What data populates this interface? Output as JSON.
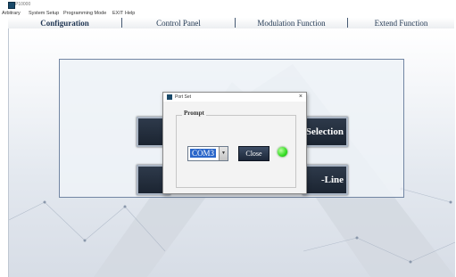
{
  "window": {
    "title": "P10000"
  },
  "menubar": {
    "items": [
      "Arbitrary",
      "System Setup",
      "Programming Mode",
      "EXIT",
      "Help"
    ]
  },
  "tabs": [
    {
      "label": "Configuration",
      "active": true
    },
    {
      "label": "Control Panel",
      "active": false
    },
    {
      "label": "Modulation Function",
      "active": false
    },
    {
      "label": "Extend Function",
      "active": false
    }
  ],
  "main": {
    "buttons": [
      "Selection",
      "-Line"
    ]
  },
  "dialog": {
    "title": "Port Set",
    "close_glyph": "×",
    "group_label": "Prompt",
    "port_value": "COM3",
    "port_arrow": "▼",
    "close_label": "Close",
    "status_color": "#33dd22"
  }
}
